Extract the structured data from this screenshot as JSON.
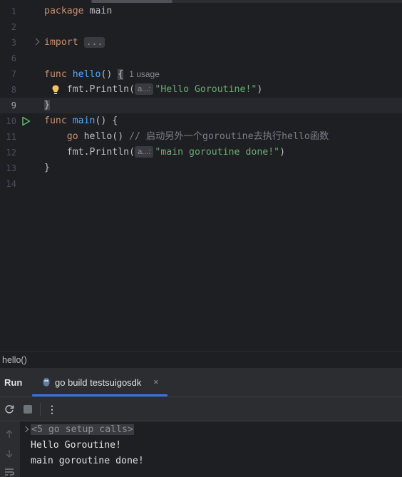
{
  "editor": {
    "lines": [
      {
        "num": "1",
        "tokens": [
          {
            "t": "package ",
            "c": "kw"
          },
          {
            "t": "main",
            "c": "pl"
          }
        ]
      },
      {
        "num": "2",
        "tokens": []
      },
      {
        "num": "3",
        "tokens": [
          {
            "t": "import ",
            "c": "kw"
          },
          {
            "t": "...",
            "c": "dots"
          }
        ],
        "fold": true
      },
      {
        "num": "6",
        "tokens": []
      },
      {
        "num": "7",
        "tokens": [
          {
            "t": "func ",
            "c": "kw"
          },
          {
            "t": "hello",
            "c": "fn"
          },
          {
            "t": "() ",
            "c": "pl"
          },
          {
            "t": "{",
            "c": "bracehl"
          }
        ],
        "usage": "1 usage"
      },
      {
        "num": "8",
        "tokens": [
          {
            "t": "    fmt.",
            "c": "pl"
          },
          {
            "t": "Println",
            "c": "pl"
          },
          {
            "t": "(",
            "c": "pl"
          },
          {
            "t": "a...:",
            "c": "hint"
          },
          {
            "t": "\"Hello Goroutine!\"",
            "c": "str"
          },
          {
            "t": ")",
            "c": "pl"
          }
        ],
        "bulb": true
      },
      {
        "num": "9",
        "tokens": [
          {
            "t": "}",
            "c": "bracehl"
          }
        ],
        "current": true
      },
      {
        "num": "10",
        "tokens": [
          {
            "t": "func ",
            "c": "kw"
          },
          {
            "t": "main",
            "c": "fn"
          },
          {
            "t": "() {",
            "c": "pl"
          }
        ],
        "run": true
      },
      {
        "num": "11",
        "tokens": [
          {
            "t": "    go ",
            "c": "kw"
          },
          {
            "t": "hello",
            "c": "pl"
          },
          {
            "t": "() ",
            "c": "pl"
          },
          {
            "t": "// 启动另外一个goroutine去执行hello函数",
            "c": "cm"
          }
        ]
      },
      {
        "num": "12",
        "tokens": [
          {
            "t": "    fmt.",
            "c": "pl"
          },
          {
            "t": "Println",
            "c": "pl"
          },
          {
            "t": "(",
            "c": "pl"
          },
          {
            "t": "a...:",
            "c": "hint"
          },
          {
            "t": "\"main goroutine done!\"",
            "c": "str"
          },
          {
            "t": ")",
            "c": "pl"
          }
        ]
      },
      {
        "num": "13",
        "tokens": [
          {
            "t": "}",
            "c": "pl"
          }
        ]
      },
      {
        "num": "14",
        "tokens": []
      }
    ]
  },
  "breadcrumb": "hello()",
  "toolwindow": {
    "title": "Run",
    "tab_label": "go build testsuigosdk",
    "tab_close": "×",
    "more_glyph": "⋮"
  },
  "console": {
    "setup_calls": "<5 go setup calls>",
    "output": [
      "Hello Goroutine!",
      "main goroutine done!"
    ]
  },
  "colors": {
    "keyword": "#cf8e6d",
    "function": "#56a8f5",
    "string": "#6aab73",
    "comment": "#7a7e85",
    "accent": "#3574f0",
    "run_icon": "#5fb865",
    "bulb": "#f2c55c"
  },
  "icons": [
    "fold-chevron-icon",
    "lightbulb-icon",
    "run-gutter-icon",
    "go-file-icon",
    "close-icon",
    "rerun-icon",
    "stop-icon",
    "more-icon",
    "scroll-up-icon",
    "scroll-down-icon",
    "wrap-icon"
  ]
}
